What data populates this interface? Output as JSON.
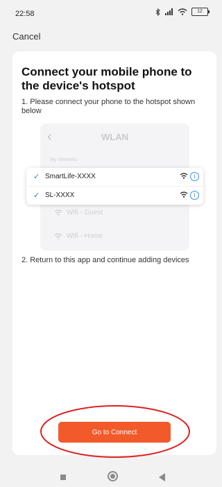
{
  "status": {
    "time": "22:58",
    "battery": "12"
  },
  "header": {
    "cancel_label": "Cancel"
  },
  "card": {
    "title": "Connect your mobile phone to the device's hotspot",
    "step1": "1. Please connect your phone to the hotspot shown below",
    "step2": "2. Return to this app and continue adding devices"
  },
  "illustration": {
    "title": "WLAN",
    "section_label": "My networks",
    "networks": [
      {
        "name": "SmartLife-XXXX"
      },
      {
        "name": "SL-XXXX"
      }
    ],
    "other_networks": [
      {
        "name": "Wifi - Guest"
      },
      {
        "name": "Wifi - Home"
      }
    ],
    "icons": {
      "connected": "check-icon",
      "signal": "wifi-icon",
      "info": "info-icon"
    }
  },
  "actions": {
    "connect_label": "Go to Connect"
  },
  "colors": {
    "accent": "#f25a2a",
    "check": "#2b78d6",
    "annotation": "#e02020"
  }
}
